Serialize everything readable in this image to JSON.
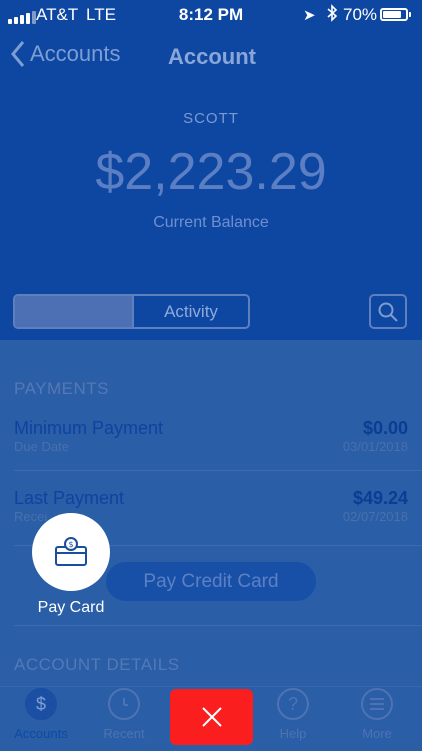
{
  "status_bar": {
    "carrier": "AT&T",
    "network": "LTE",
    "time": "8:12 PM",
    "battery": "70%"
  },
  "nav": {
    "back_label": "Accounts",
    "title": "Account"
  },
  "account": {
    "name": "SCOTT",
    "balance": "$2,223.29",
    "balance_label": "Current Balance"
  },
  "segments": {
    "first": "",
    "second": "Activity"
  },
  "payments": {
    "header": "PAYMENTS",
    "minimum": {
      "title": "Minimum Payment",
      "subtitle": "Due Date",
      "value": "$0.00",
      "date": "03/01/2018"
    },
    "last": {
      "title": "Last Payment",
      "subtitle": "Recei",
      "value": "$49.24",
      "date": "02/07/2018"
    }
  },
  "pay_button": "Pay Credit Card",
  "fab": {
    "label": "Pay Card",
    "icon": "card-dollar-icon"
  },
  "account_details": {
    "header": "ACCOUNT DETAILS"
  },
  "tabs": [
    {
      "label": "Accounts",
      "icon": "dollar-coin-icon"
    },
    {
      "label": "Recent",
      "icon": "clock-icon"
    },
    {
      "label": "Help",
      "icon": "question-icon"
    },
    {
      "label": "More",
      "icon": "menu-icon"
    }
  ],
  "colors": {
    "primary": "#0d47a1",
    "panel": "#2a5ea7",
    "close": "#fb1e1e"
  }
}
